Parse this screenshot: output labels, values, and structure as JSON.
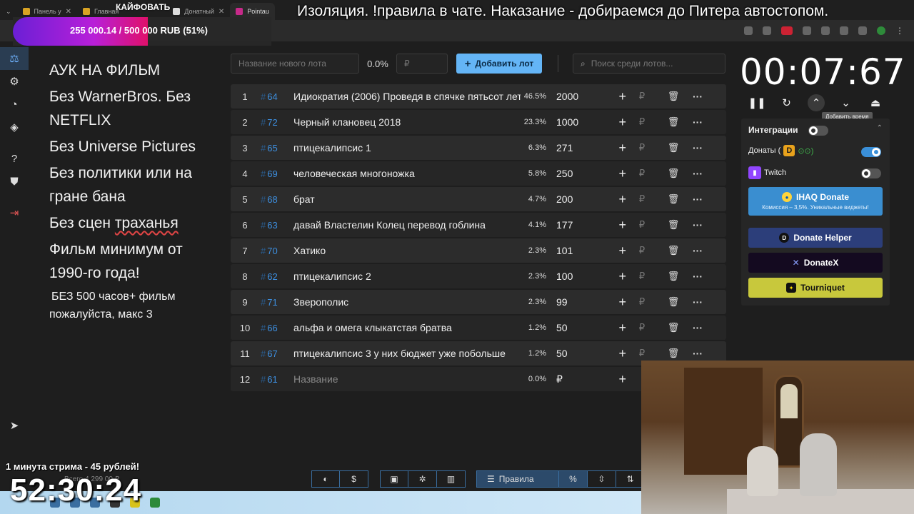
{
  "browser": {
    "tabs": [
      {
        "label": "Панель у",
        "active": false
      },
      {
        "label": "Главная",
        "active": false
      },
      {
        "label": "Донатный",
        "active": false
      },
      {
        "label": "Pointau",
        "active": true
      }
    ]
  },
  "overlay": {
    "progress_text": "255 000.14 / 500 000 RUB (51%)",
    "progress_fraction": 0.51,
    "brand": "КАЙФОВАТЬ",
    "top_caption": "Изоляция. !правила в чате. Наказание - добираемся до Питера автостопом.",
    "stream_caption": "1 минута стрима - 45 рублей!",
    "stream_timer": "52:30:24",
    "tiny_note": "Всего 4 299 00 ₽"
  },
  "rules": [
    {
      "text": "АУК НА ФИЛЬМ",
      "size": "large"
    },
    {
      "text": "Без WarnerBros. Без NETFLIX",
      "size": "large"
    },
    {
      "text": "Без Universe Pictures",
      "size": "large"
    },
    {
      "text": "Без политики или на гране бана",
      "size": "large"
    },
    {
      "text_before": "Без сцен ",
      "text_marked": "траханья",
      "size": "large"
    },
    {
      "text": "Фильм минимум от 1990-го года!",
      "size": "large"
    },
    {
      "text": "БЕЗ 500 часов+ фильм",
      "size": "small"
    },
    {
      "text": "пожалуйста, макс 3",
      "size": "small"
    }
  ],
  "controls": {
    "lot_name_placeholder": "Название нового лота",
    "percent": "0.0%",
    "rub_placeholder": "₽",
    "add_button": "Добавить лот",
    "search_placeholder": "Поиск среди лотов..."
  },
  "lots": [
    {
      "pos": "1",
      "id": "64",
      "name": "Идиократия (2006) Проведя в спячке пятьсот лет",
      "pct": "46.5%",
      "amount": "2000"
    },
    {
      "pos": "2",
      "id": "72",
      "name": "Черный клановец 2018",
      "pct": "23.3%",
      "amount": "1000"
    },
    {
      "pos": "3",
      "id": "65",
      "name": "птицекалипсис 1",
      "pct": "6.3%",
      "amount": "271"
    },
    {
      "pos": "4",
      "id": "69",
      "name": "человеческая многоножка",
      "pct": "5.8%",
      "amount": "250"
    },
    {
      "pos": "5",
      "id": "68",
      "name": "брат",
      "pct": "4.7%",
      "amount": "200"
    },
    {
      "pos": "6",
      "id": "63",
      "name": "давай Властелин Колец перевод гоблина",
      "pct": "4.1%",
      "amount": "177"
    },
    {
      "pos": "7",
      "id": "70",
      "name": "Хатико",
      "pct": "2.3%",
      "amount": "101"
    },
    {
      "pos": "8",
      "id": "62",
      "name": "птицекалипсис 2",
      "pct": "2.3%",
      "amount": "100"
    },
    {
      "pos": "9",
      "id": "71",
      "name": "Зверополис",
      "pct": "2.3%",
      "amount": "99"
    },
    {
      "pos": "10",
      "id": "66",
      "name": "альфа и омега клыкатстая братва",
      "pct": "1.2%",
      "amount": "50"
    },
    {
      "pos": "11",
      "id": "67",
      "name": "птицекалипсис 3 у них бюджет уже побольше",
      "pct": "1.2%",
      "amount": "50"
    }
  ],
  "new_lot": {
    "pos": "12",
    "id": "61",
    "name": "Название",
    "pct": "0.0%",
    "amount": "₽"
  },
  "lot_glyphs": {
    "hash": "#",
    "plus": "+",
    "rub": "₽",
    "delete": "🗑",
    "more": "···"
  },
  "timer": {
    "display": "00:07:67",
    "tooltip": "Добавить время"
  },
  "integrations": {
    "title": "Интеграции",
    "donats_label": "Донаты (",
    "donats_suffix": "⊙⊙)",
    "donats_on": true,
    "twitch_label": "Twitch",
    "twitch_on": false,
    "ihaq_label": "IHAQ Donate",
    "ihaq_sub": "Комиссия – 3,5%. Уникальные виджеты!",
    "helper_label": "Donate Helper",
    "donatex_label": "DonateX",
    "tourniquet_label": "Tourniquet"
  },
  "bottom": {
    "rules_label": "Правила",
    "percent_label": "%"
  },
  "colors": {
    "accent": "#64b5f6",
    "lot_id": "#3d8fe0",
    "twitch": "#9146ff"
  }
}
